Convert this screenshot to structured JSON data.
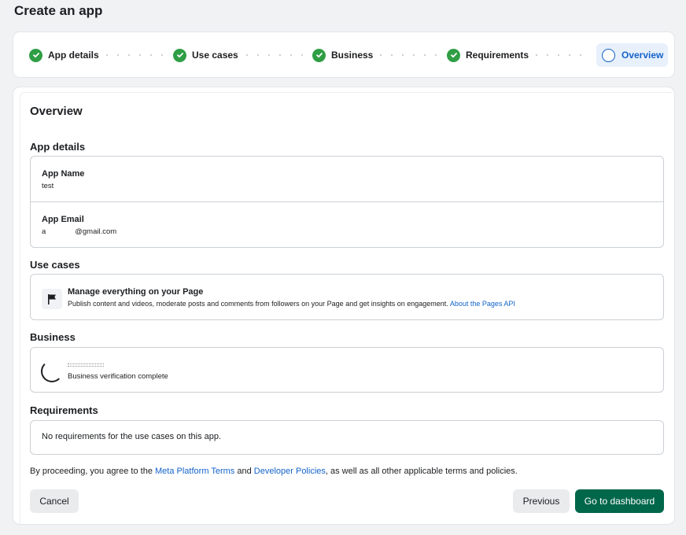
{
  "page": {
    "title": "Create an app"
  },
  "stepper": {
    "steps": [
      {
        "label": "App details",
        "state": "complete"
      },
      {
        "label": "Use cases",
        "state": "complete"
      },
      {
        "label": "Business",
        "state": "complete"
      },
      {
        "label": "Requirements",
        "state": "complete"
      },
      {
        "label": "Overview",
        "state": "current"
      }
    ]
  },
  "overview": {
    "heading": "Overview",
    "app_details": {
      "heading": "App details",
      "app_name_label": "App Name",
      "app_name_value": "test",
      "app_email_label": "App Email",
      "app_email_value": "a              @gmail.com"
    },
    "use_cases": {
      "heading": "Use cases",
      "title": "Manage everything on your Page",
      "description": "Publish content and videos, moderate posts and comments from followers on your Page and get insights on engagement.",
      "link": "About the Pages API",
      "icon": "flag-icon"
    },
    "business": {
      "heading": "Business",
      "status": "Business verification complete"
    },
    "requirements": {
      "heading": "Requirements",
      "text": "No requirements for the use cases on this app."
    },
    "terms": {
      "prefix": "By proceeding, you agree to the",
      "link1": "Meta Platform Terms",
      "and": "and",
      "link2": "Developer Policies",
      "suffix": ", as well as all other applicable terms and policies."
    }
  },
  "buttons": {
    "cancel": "Cancel",
    "previous": "Previous",
    "go_to_dashboard": "Go to dashboard"
  },
  "colors": {
    "primary": "#00674b",
    "link": "#1463c9",
    "complete": "#2f9e44"
  }
}
